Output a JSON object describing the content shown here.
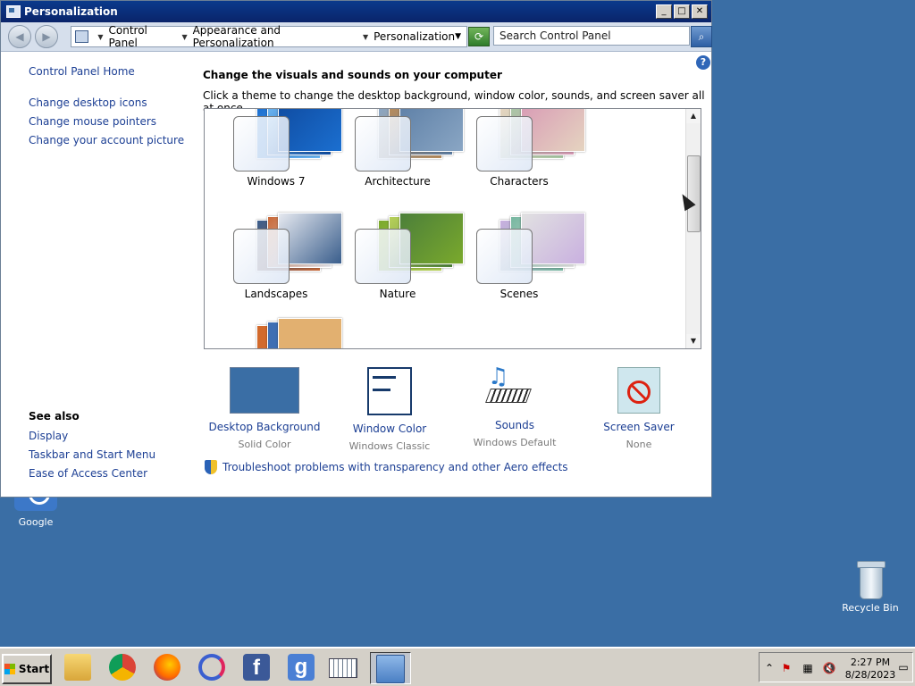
{
  "window": {
    "title": "Personalization",
    "controls": {
      "min": "_",
      "max": "□",
      "close": "✕"
    }
  },
  "address": {
    "crumbs": [
      "Control Panel",
      "Appearance and Personalization",
      "Personalization"
    ],
    "search_placeholder": "Search Control Panel"
  },
  "leftnav": {
    "home": "Control Panel Home",
    "links": [
      "Change desktop icons",
      "Change mouse pointers",
      "Change your account picture"
    ],
    "see_also_title": "See also",
    "see_also": [
      "Display",
      "Taskbar and Start Menu",
      "Ease of Access Center"
    ]
  },
  "main": {
    "heading": "Change the visuals and sounds on your computer",
    "subheading": "Click a theme to change the desktop background, window color, sounds, and screen saver all at once."
  },
  "themes": [
    {
      "name": "Windows 7",
      "colors": [
        "#1b6fd0",
        "#6cb6f2",
        "#0f4ba0"
      ]
    },
    {
      "name": "Architecture",
      "colors": [
        "#8aa6c4",
        "#b98c5a",
        "#5d7fa6"
      ]
    },
    {
      "name": "Characters",
      "colors": [
        "#e5d4c0",
        "#a7c7a4",
        "#d89ab5"
      ]
    },
    {
      "name": "Landscapes",
      "colors": [
        "#3a5e8c",
        "#c86a3a",
        "#e6e9f0"
      ]
    },
    {
      "name": "Nature",
      "colors": [
        "#7aa92c",
        "#b7d05a",
        "#4c7f3a"
      ]
    },
    {
      "name": "Scenes",
      "colors": [
        "#c9b0e0",
        "#77b7a0",
        "#e1e1e1"
      ]
    }
  ],
  "settings": [
    {
      "label": "Desktop Background",
      "value": "Solid Color"
    },
    {
      "label": "Window Color",
      "value": "Windows Classic"
    },
    {
      "label": "Sounds",
      "value": "Windows Default"
    },
    {
      "label": "Screen Saver",
      "value": "None"
    }
  ],
  "troubleshoot": "Troubleshoot problems with transparency and other Aero effects",
  "desktop": {
    "google": "Google",
    "recycle": "Recycle Bin"
  },
  "taskbar": {
    "start": "Start",
    "time": "2:27 PM",
    "date": "8/28/2023"
  },
  "colors": {
    "desktop": "#3a6ea5",
    "link": "#1c3f94",
    "title_bar": "#0a246a"
  }
}
